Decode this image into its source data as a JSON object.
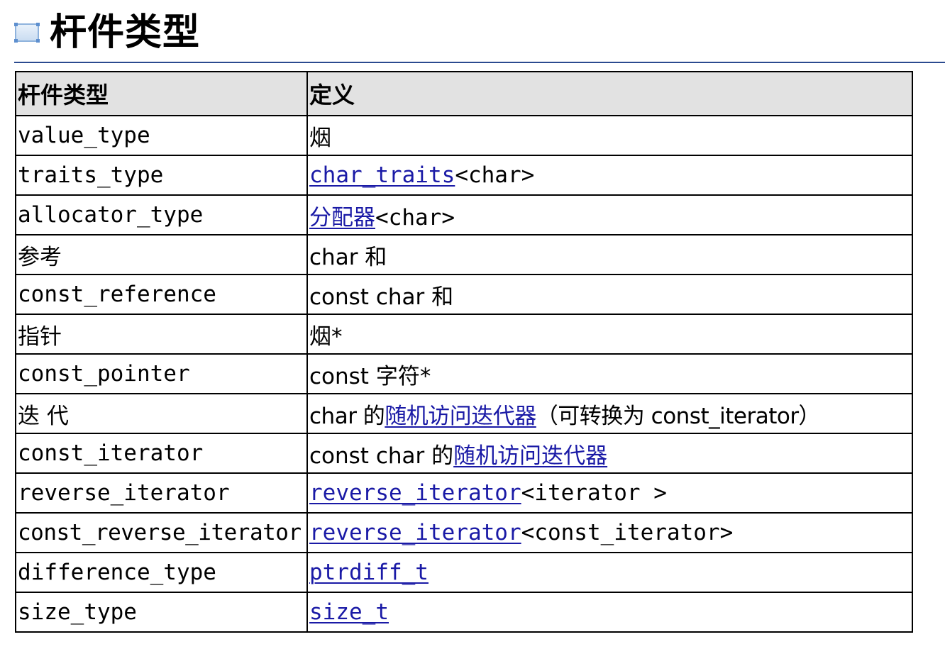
{
  "heading": {
    "icon": "section-box-icon",
    "title": "杆件类型"
  },
  "table": {
    "headers": [
      "杆件类型",
      "定义"
    ],
    "rows": [
      {
        "name": "value_type",
        "def": [
          {
            "text": "烟"
          }
        ]
      },
      {
        "name": "traits_type",
        "def": [
          {
            "text": "char_traits",
            "link": true
          },
          {
            "text": "<char>"
          }
        ]
      },
      {
        "name": "allocator_type",
        "def": [
          {
            "text": "分配器",
            "link": true
          },
          {
            "text": "<char>"
          }
        ]
      },
      {
        "name": "参考",
        "def": [
          {
            "text": "char 和"
          }
        ]
      },
      {
        "name": "const_reference",
        "def": [
          {
            "text": "const char 和"
          }
        ]
      },
      {
        "name": "指针",
        "def": [
          {
            "text": "烟*"
          }
        ]
      },
      {
        "name": "const_pointer",
        "def": [
          {
            "text": "const 字符*"
          }
        ]
      },
      {
        "name": "迭 代",
        "def": [
          {
            "text": "char 的"
          },
          {
            "text": "随机访问迭代器",
            "link": true
          },
          {
            "text": "（可转换为 const_iterator）"
          }
        ]
      },
      {
        "name": "const_iterator",
        "def": [
          {
            "text": "const char 的"
          },
          {
            "text": "随机访问迭代器",
            "link": true
          }
        ]
      },
      {
        "name": "reverse_iterator",
        "def": [
          {
            "text": "reverse_iterator",
            "link": true
          },
          {
            "text": "<iterator >"
          }
        ]
      },
      {
        "name": "const_reverse_iterator",
        "def": [
          {
            "text": "reverse_iterator",
            "link": true
          },
          {
            "text": "<const_iterator>"
          }
        ]
      },
      {
        "name": "difference_type",
        "def": [
          {
            "text": "ptrdiff_t",
            "link": true
          }
        ]
      },
      {
        "name": "size_type",
        "def": [
          {
            "text": "size_t",
            "link": true
          }
        ]
      }
    ]
  },
  "colors": {
    "link": "#1a1aa6",
    "header_bg": "#e2e2e2",
    "rule": "#2b4a8f"
  }
}
